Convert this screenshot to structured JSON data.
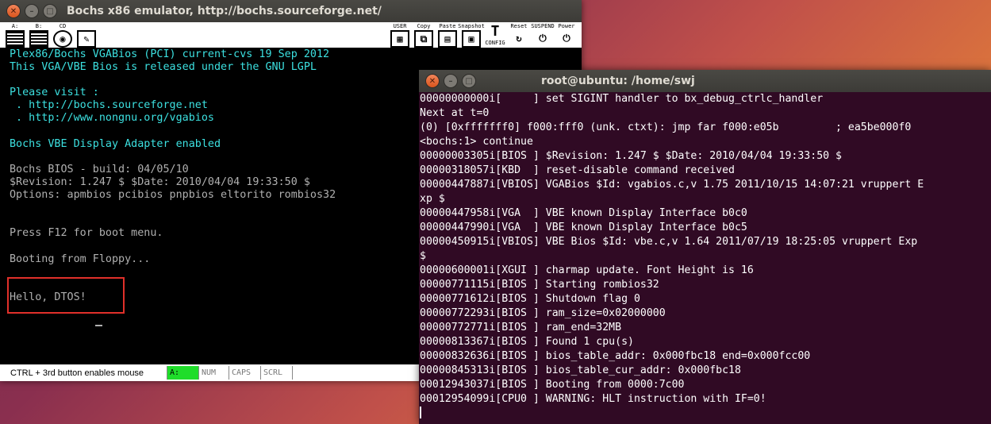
{
  "bochs": {
    "title": "Bochs x86 emulator, http://bochs.sourceforge.net/",
    "toolbar": {
      "floppy_a": "A:",
      "floppy_b": "B:",
      "cdrom": "CD",
      "user": "USER",
      "copy": "Copy",
      "paste": "Paste",
      "snapshot": "Snapshot",
      "config": "CONFIG",
      "reset": "Reset",
      "suspend": "SUSPEND",
      "power": "Power"
    },
    "screen_lines": [
      {
        "text": "Plex86/Bochs VGABios (PCI) current-cvs 19 Sep 2012",
        "cls": "cyan"
      },
      {
        "text": "This VGA/VBE Bios is released under the GNU LGPL",
        "cls": "cyan"
      },
      {
        "text": "",
        "cls": ""
      },
      {
        "text": "Please visit :",
        "cls": "cyan"
      },
      {
        "text": " . http://bochs.sourceforge.net",
        "cls": "cyan"
      },
      {
        "text": " . http://www.nongnu.org/vgabios",
        "cls": "cyan"
      },
      {
        "text": "",
        "cls": ""
      },
      {
        "text": "Bochs VBE Display Adapter enabled",
        "cls": "cyan"
      },
      {
        "text": "",
        "cls": ""
      },
      {
        "text": "Bochs BIOS - build: 04/05/10",
        "cls": ""
      },
      {
        "text": "$Revision: 1.247 $ $Date: 2010/04/04 19:33:50 $",
        "cls": ""
      },
      {
        "text": "Options: apmbios pcibios pnpbios eltorito rombios32",
        "cls": ""
      },
      {
        "text": "",
        "cls": ""
      },
      {
        "text": "",
        "cls": ""
      },
      {
        "text": "Press F12 for boot menu.",
        "cls": ""
      },
      {
        "text": "",
        "cls": ""
      },
      {
        "text": "Booting from Floppy...",
        "cls": ""
      },
      {
        "text": "",
        "cls": ""
      },
      {
        "text": "",
        "cls": ""
      },
      {
        "text": "Hello, DTOS!",
        "cls": ""
      }
    ],
    "status": {
      "message": "CTRL + 3rd button enables mouse",
      "drive": "A:",
      "num": "NUM",
      "caps": "CAPS",
      "scrl": "SCRL"
    }
  },
  "terminal": {
    "title": "root@ubuntu: /home/swj",
    "lines": [
      "00000000000i[     ] set SIGINT handler to bx_debug_ctrlc_handler",
      "Next at t=0",
      "(0) [0xfffffff0] f000:fff0 (unk. ctxt): jmp far f000:e05b         ; ea5be000f0",
      "<bochs:1> continue",
      "00000003305i[BIOS ] $Revision: 1.247 $ $Date: 2010/04/04 19:33:50 $",
      "00000318057i[KBD  ] reset-disable command received",
      "00000447887i[VBIOS] VGABios $Id: vgabios.c,v 1.75 2011/10/15 14:07:21 vruppert E",
      "xp $",
      "00000447958i[VGA  ] VBE known Display Interface b0c0",
      "00000447990i[VGA  ] VBE known Display Interface b0c5",
      "00000450915i[VBIOS] VBE Bios $Id: vbe.c,v 1.64 2011/07/19 18:25:05 vruppert Exp",
      "$",
      "00000600001i[XGUI ] charmap update. Font Height is 16",
      "00000771115i[BIOS ] Starting rombios32",
      "00000771612i[BIOS ] Shutdown flag 0",
      "00000772293i[BIOS ] ram_size=0x02000000",
      "00000772771i[BIOS ] ram_end=32MB",
      "00000813367i[BIOS ] Found 1 cpu(s)",
      "00000832636i[BIOS ] bios_table_addr: 0x000fbc18 end=0x000fcc00",
      "00000845313i[BIOS ] bios_table_cur_addr: 0x000fbc18",
      "00012943037i[BIOS ] Booting from 0000:7c00",
      "00012954099i[CPU0 ] WARNING: HLT instruction with IF=0!"
    ]
  },
  "colors": {
    "accent_red": "#e0302a",
    "terminal_bg": "#300a24",
    "status_on": "#1fdd2a"
  }
}
